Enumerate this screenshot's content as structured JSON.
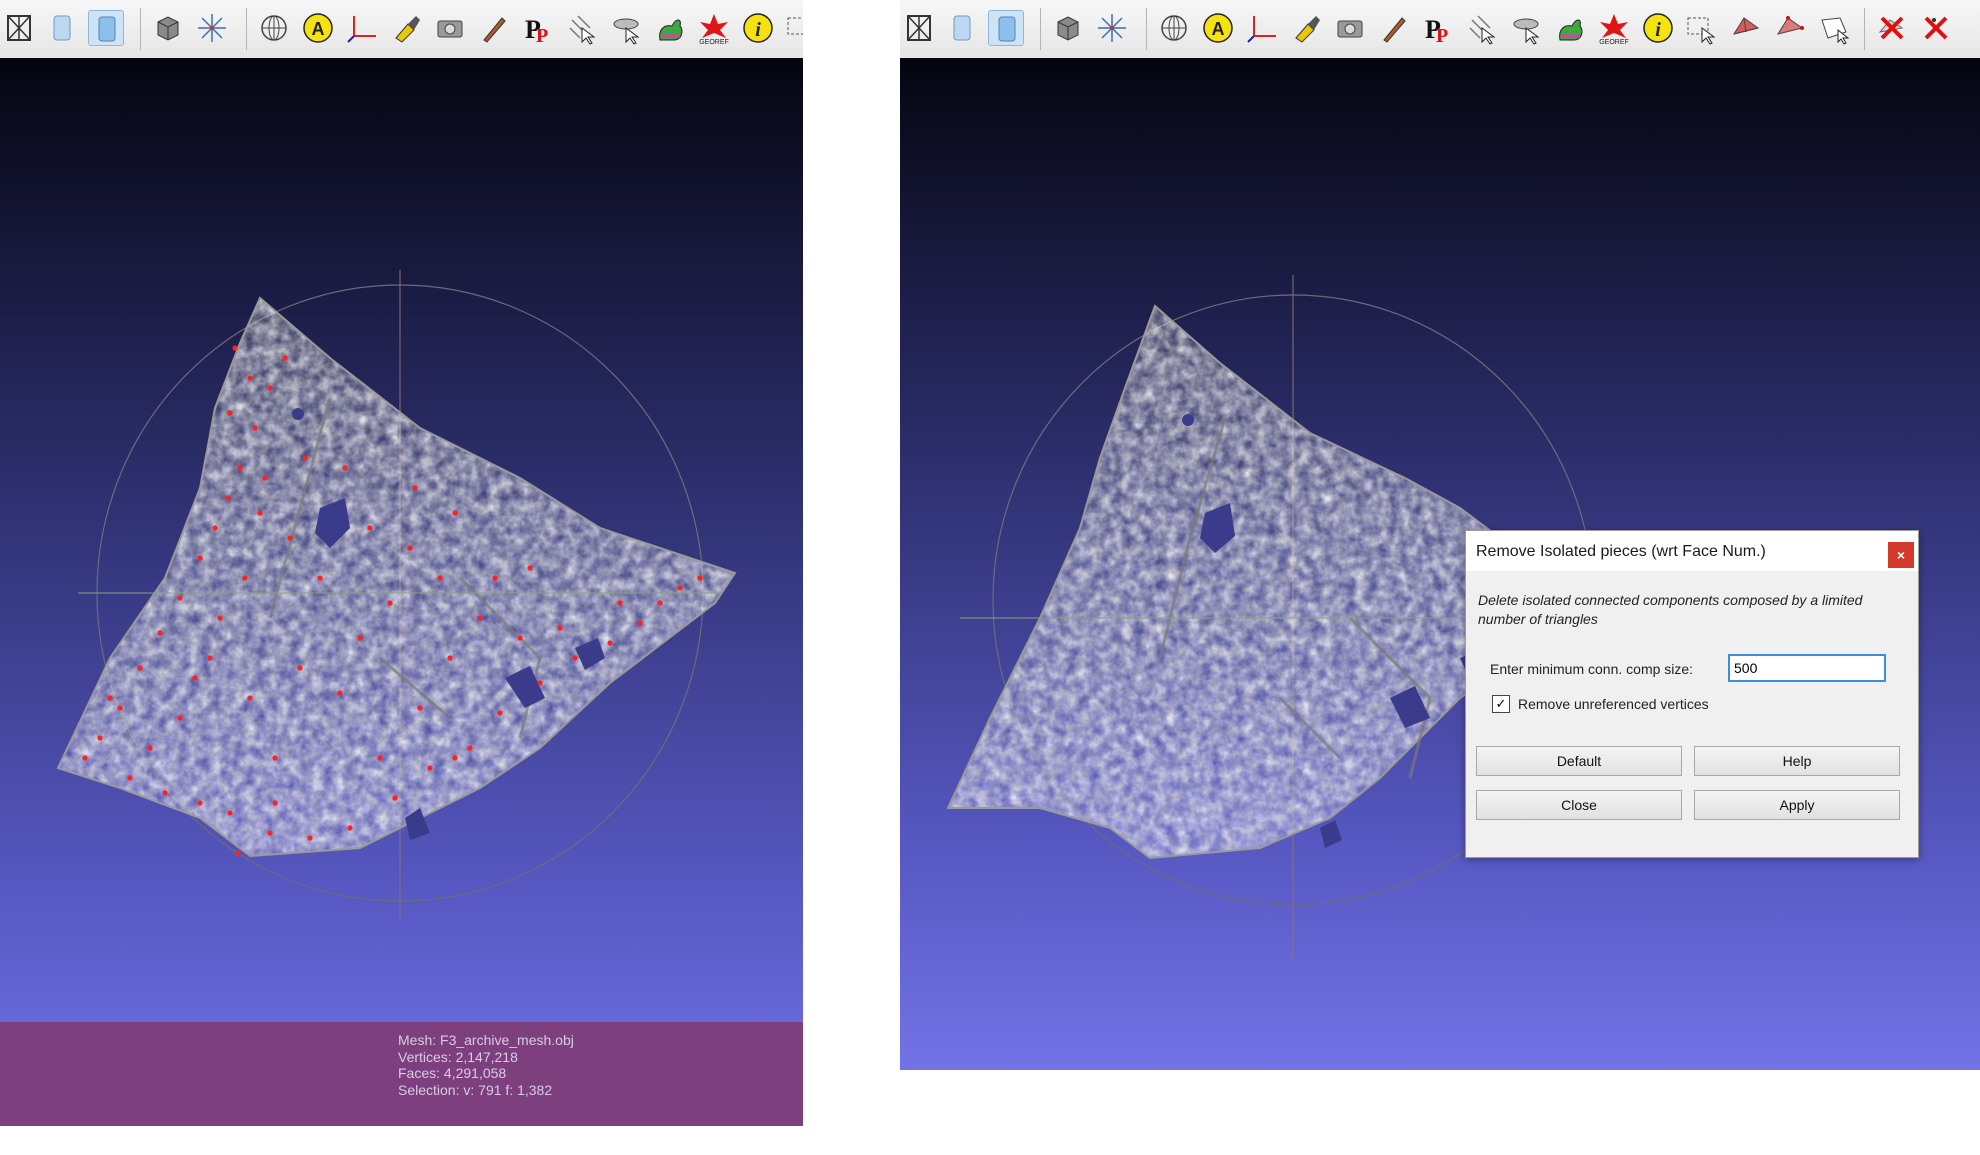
{
  "left_viewer": {
    "info": {
      "mesh": "Mesh: F3_archive_mesh.obj",
      "vertices": "Vertices: 2,147,218",
      "faces": "Faces: 4,291,058",
      "selection": "Selection: v: 791 f: 1,382"
    }
  },
  "right_viewer": {
    "dialog": {
      "title": "Remove Isolated pieces (wrt Face Num.)",
      "close_glyph": "×",
      "description": "Delete isolated connected components composed by a limited number of triangles",
      "min_size_label": "Enter minimum conn. comp size:",
      "min_size_value": "500",
      "remove_unreferenced_label": "Remove unreferenced vertices",
      "remove_unreferenced_checked": true,
      "buttons": {
        "default": "Default",
        "help": "Help",
        "close": "Close",
        "apply": "Apply"
      }
    }
  },
  "toolbar_icons_left": [
    "wireframe-cube-icon",
    "cylinder-icon",
    "cylinder-selected-icon",
    "grid-cube-icon",
    "axes-star-icon",
    "sphere-grid-icon",
    "annotation-a-icon",
    "axis-icon",
    "paint-brush-icon",
    "camera-icon",
    "pen-icon",
    "pp-icon",
    "point-picker-icon",
    "satellite-icon",
    "bunny-icon",
    "georef-icon",
    "info-icon",
    "select-icon"
  ],
  "toolbar_icons_right_extra": [
    "select-faces-icon",
    "select-vertices-icon",
    "select-region-icon",
    "select-connected-icon",
    "delete-selected-faces-icon",
    "delete-selected-vertices-icon"
  ],
  "colors": {
    "info_bar": "#7e3f7f",
    "viewport_top": "#050510",
    "viewport_bottom": "#7273e6",
    "dialog_close": "#d33a2c"
  },
  "georef_label": "GEOREF"
}
